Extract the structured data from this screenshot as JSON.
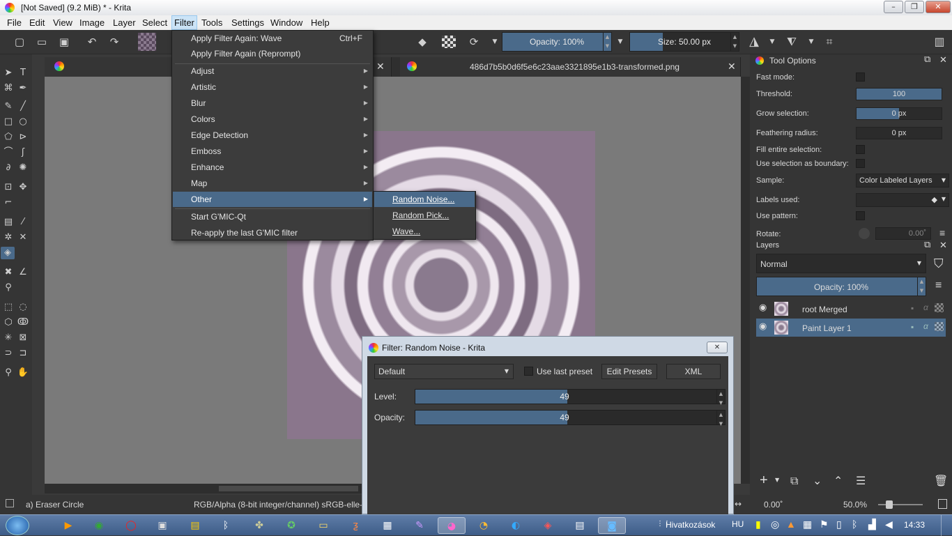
{
  "window": {
    "title": "[Not Saved]  (9.2 MiB)  * - Krita",
    "minimize": "–",
    "maximize": "❐",
    "close": "✕"
  },
  "menubar": [
    "File",
    "Edit",
    "View",
    "Image",
    "Layer",
    "Select",
    "Filter",
    "Tools",
    "Settings",
    "Window",
    "Help"
  ],
  "toolbar": {
    "opacity_label": "Opacity: 100%",
    "opacity_level": 1.0,
    "size_label": "Size: 50.00 px",
    "size_level": 0.3
  },
  "tabs": [
    {
      "name": "486d7b5b0d6f5e6c23aae3321895e1b3-transformed.png",
      "close": "✕"
    }
  ],
  "filter_menu": {
    "items": [
      {
        "label": "Apply Filter Again: Wave",
        "shortcut": "Ctrl+F"
      },
      {
        "label": "Apply Filter Again (Reprompt)"
      },
      {
        "label": "Adjust",
        "submenu": true
      },
      {
        "label": "Artistic",
        "submenu": true
      },
      {
        "label": "Blur",
        "submenu": true
      },
      {
        "label": "Colors",
        "submenu": true
      },
      {
        "label": "Edge Detection",
        "submenu": true
      },
      {
        "label": "Emboss",
        "submenu": true
      },
      {
        "label": "Enhance",
        "submenu": true
      },
      {
        "label": "Map",
        "submenu": true
      },
      {
        "label": "Other",
        "submenu": true,
        "highlighted": true
      },
      {
        "label": "Start G'MIC-Qt"
      },
      {
        "label": "Re-apply the last G'MIC filter"
      }
    ],
    "arrow": "▶"
  },
  "other_submenu": [
    {
      "label": "Random Noise...",
      "highlighted": true
    },
    {
      "label": "Random Pick..."
    },
    {
      "label": "Wave..."
    }
  ],
  "tool_options": {
    "title": "Tool Options",
    "rows": [
      {
        "label": "Fast mode:",
        "type": "checkbox"
      },
      {
        "label": "Threshold:",
        "value": "100",
        "level": 1.0
      },
      {
        "label": "Grow selection:",
        "value": "0 px",
        "level": 0.5
      },
      {
        "label": "Feathering radius:",
        "value": "0 px",
        "level": 0
      },
      {
        "label": "Fill entire selection:",
        "type": "checkbox"
      },
      {
        "label": "Use selection as boundary:",
        "type": "checkbox"
      },
      {
        "label": "Sample:",
        "value": "Color Labeled Layers"
      },
      {
        "label": "Labels used:",
        "value": ""
      },
      {
        "label": "Use pattern:",
        "type": "checkbox"
      },
      {
        "label": "Rotate:",
        "value": "0.00˚"
      }
    ]
  },
  "layers": {
    "title": "Layers",
    "blend_mode": "Normal",
    "opacity": "Opacity:  100%",
    "items": [
      {
        "name": "root Merged",
        "selected": false
      },
      {
        "name": "Paint Layer 1",
        "selected": true
      }
    ]
  },
  "dialog": {
    "title": "Filter: Random Noise - Krita",
    "preset": "Default",
    "use_last_preset": "Use last preset",
    "edit_presets": "Edit Presets",
    "xml": "XML",
    "level_label": "Level:",
    "level_value": "49",
    "level_fraction": 0.49,
    "opacity_label": "Opacity:",
    "opacity_value": "49",
    "opacity_fraction": 0.49
  },
  "status": {
    "brush": "a) Eraser Circle",
    "color_space": "RGB/Alpha (8-bit integer/channel)  sRGB-elle-",
    "rotation": "0.00˚",
    "zoom": "50.0%"
  },
  "taskbar": {
    "lang": "HU",
    "links": "Hivatkozások",
    "time": "14:33"
  },
  "colors": {
    "accent": "#4a6a8a",
    "bg": "#353535"
  }
}
